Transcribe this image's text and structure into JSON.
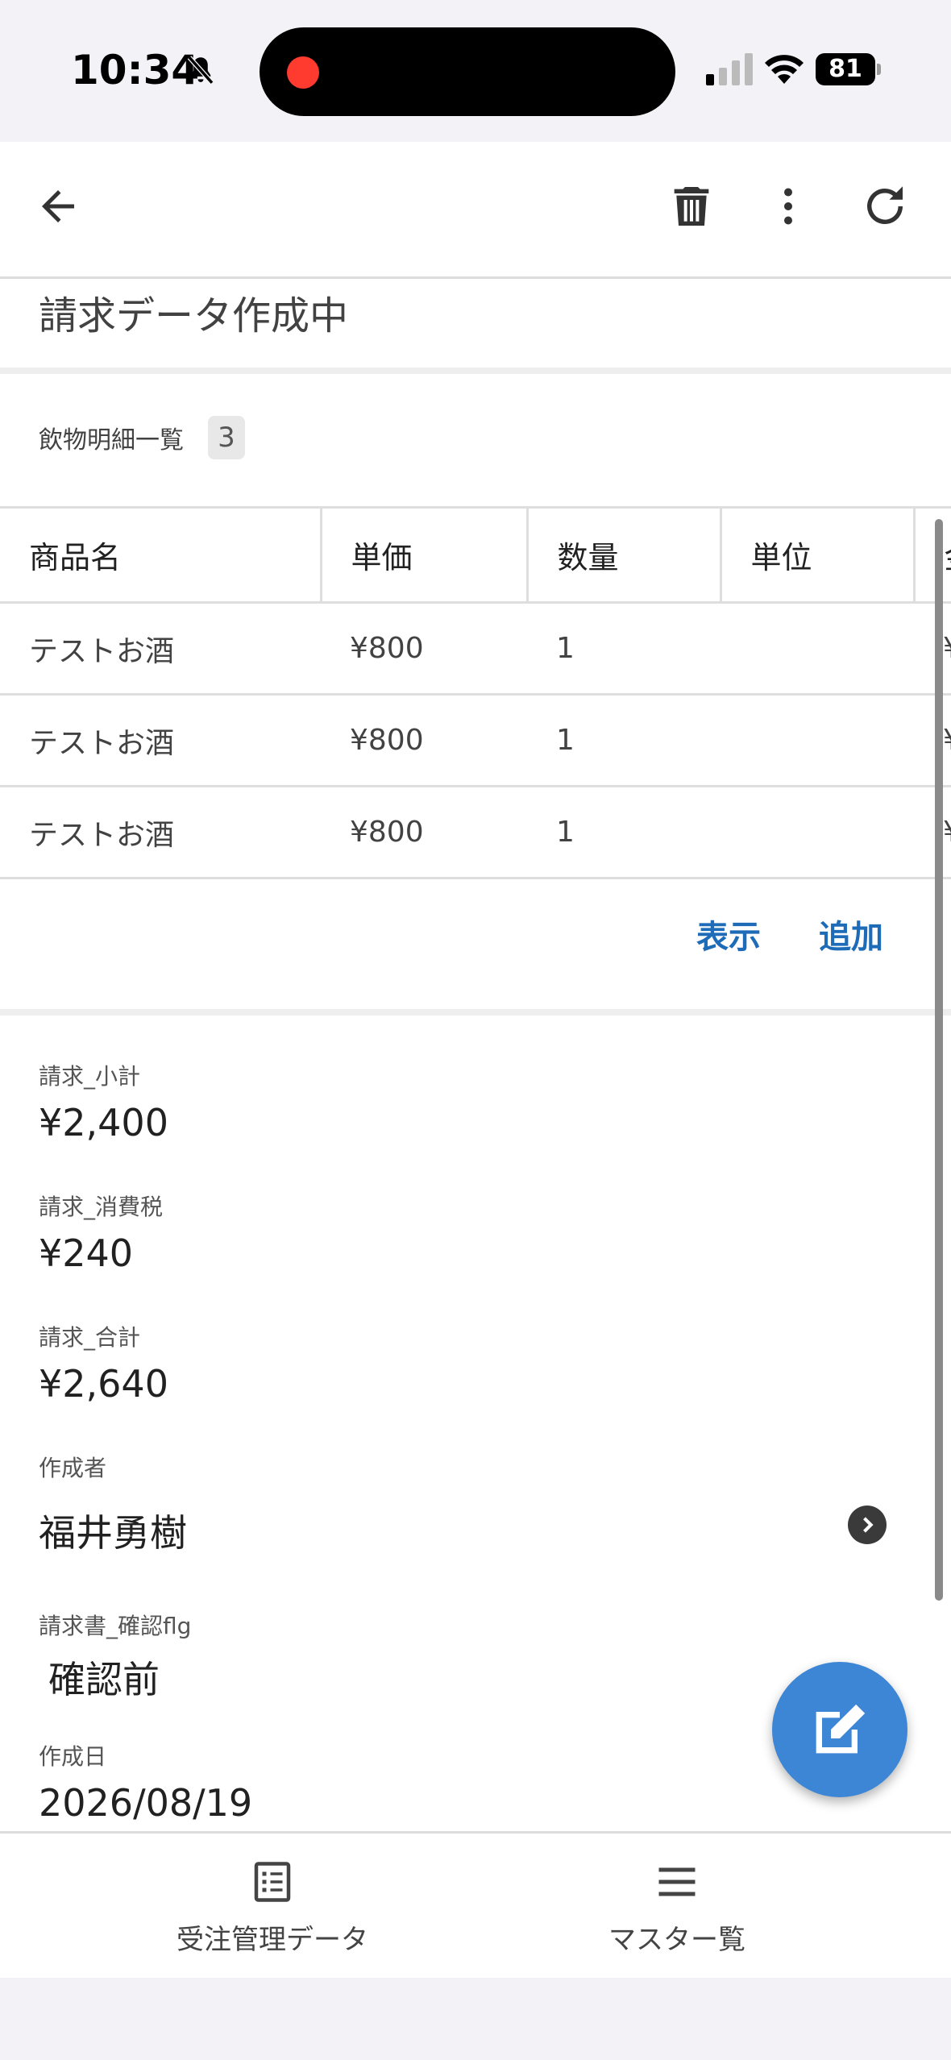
{
  "status_bar": {
    "time": "10:34",
    "battery": "81"
  },
  "record": {
    "status": "請求データ作成中"
  },
  "items_list": {
    "title": "飲物明細一覧",
    "count": "3",
    "columns": [
      "商品名",
      "単価",
      "数量",
      "単位",
      "金"
    ],
    "rows": [
      [
        "テストお酒",
        "¥800",
        "1",
        "",
        "¥"
      ],
      [
        "テストお酒",
        "¥800",
        "1",
        "",
        "¥"
      ],
      [
        "テストお酒",
        "¥800",
        "1",
        "",
        "¥"
      ]
    ],
    "show_label": "表示",
    "add_label": "追加"
  },
  "fields": {
    "subtotal_label": "請求_小計",
    "subtotal_value": "¥2,400",
    "tax_label": "請求_消費税",
    "tax_value": "¥240",
    "total_label": "請求_合計",
    "total_value": "¥2,640",
    "creator_label": "作成者",
    "creator_value": "福井勇樹",
    "confirm_label": "請求書_確認flg",
    "confirm_value": "確認前",
    "created_label": "作成日",
    "created_value": "2026/08/19"
  },
  "bottom_nav": {
    "orders_label": "受注管理データ",
    "master_label": "マスター覧"
  },
  "icons": {
    "back": "arrow-left-icon",
    "delete": "trash-icon",
    "more": "more-vert-icon",
    "refresh": "refresh-icon",
    "edit": "edit-icon",
    "orders": "list-document-icon",
    "master": "menu-icon",
    "chevron": "chevron-right-icon"
  },
  "colors": {
    "accent": "#1e6bb8",
    "fab": "#3d86d6",
    "recording": "#ff3b30"
  }
}
